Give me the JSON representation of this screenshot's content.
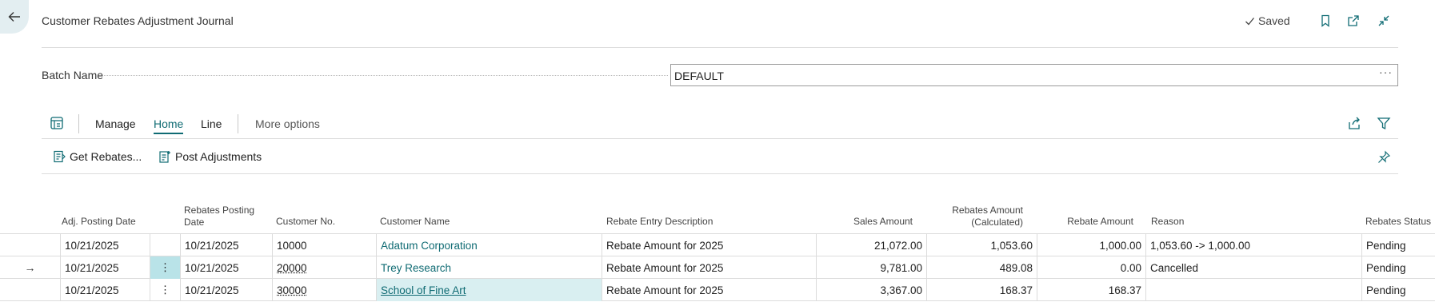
{
  "header": {
    "title": "Customer Rebates Adjustment Journal",
    "saved_label": "Saved"
  },
  "batch": {
    "label": "Batch Name",
    "value": "DEFAULT",
    "more": "···"
  },
  "actionbar": {
    "tabs": [
      "Manage",
      "Home",
      "Line"
    ],
    "active_tab": "Home",
    "more_options": "More options"
  },
  "actions": {
    "get_rebates": "Get Rebates...",
    "post_adjustments": "Post Adjustments"
  },
  "table": {
    "columns": {
      "adj_posting_date": "Adj. Posting Date",
      "rebates_posting_date_1": "Rebates Posting",
      "rebates_posting_date_2": "Date",
      "customer_no": "Customer No.",
      "customer_name": "Customer Name",
      "description": "Rebate Entry Description",
      "sales_amount": "Sales Amount",
      "rebates_calc_1": "Rebates Amount",
      "rebates_calc_2": "(Calculated)",
      "rebate_amount": "Rebate Amount",
      "reason": "Reason",
      "status": "Rebates Status"
    },
    "rows": [
      {
        "adj_posting_date": "10/21/2025",
        "rebates_posting_date": "10/21/2025",
        "customer_no": "10000",
        "customer_name": "Adatum Corporation",
        "description": "Rebate Amount for 2025",
        "sales_amount": "21,072.00",
        "rebates_calc": "1,053.60",
        "rebate_amount": "1,000.00",
        "reason": "1,053.60 -> 1,000.00",
        "status": "Pending"
      },
      {
        "adj_posting_date": "10/21/2025",
        "rebates_posting_date": "10/21/2025",
        "customer_no": "20000",
        "customer_name": "Trey Research",
        "description": "Rebate Amount for 2025",
        "sales_amount": "9,781.00",
        "rebates_calc": "489.08",
        "rebate_amount": "0.00",
        "reason": "Cancelled",
        "status": "Pending"
      },
      {
        "adj_posting_date": "10/21/2025",
        "rebates_posting_date": "10/21/2025",
        "customer_no": "30000",
        "customer_name": "School of Fine Art",
        "description": "Rebate Amount for 2025",
        "sales_amount": "3,367.00",
        "rebates_calc": "168.37",
        "rebate_amount": "168.37",
        "reason": "",
        "status": "Pending"
      }
    ],
    "row_menu_glyph": "⋮",
    "current_row_glyph": "→"
  },
  "colors": {
    "accent": "#0f6b73",
    "selection": "#d9eff1",
    "menu_highlight": "#b9e3e8",
    "back_button": "#e3eef1"
  }
}
